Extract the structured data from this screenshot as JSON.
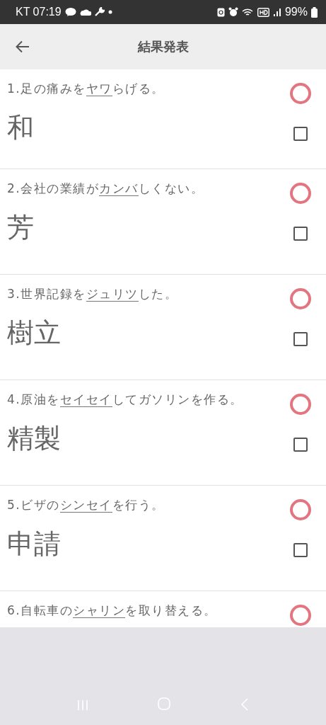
{
  "status_bar": {
    "carrier_time": "KT 07:19",
    "battery": "99%"
  },
  "header": {
    "title": "結果発表"
  },
  "questions": [
    {
      "before": "1.足の痛みを",
      "target": "ヤワ",
      "after": "らげる。",
      "answer": "和",
      "correct": true,
      "checked": false
    },
    {
      "before": "2.会社の業績が",
      "target": "カンバ",
      "after": "しくない。",
      "answer": "芳",
      "correct": true,
      "checked": false
    },
    {
      "before": "3.世界記録を",
      "target": "ジュリツ",
      "after": "した。",
      "answer": "樹立",
      "correct": true,
      "checked": false
    },
    {
      "before": "4.原油を",
      "target": "セイセイ",
      "after": "してガソリンを作る。",
      "answer": "精製",
      "correct": true,
      "checked": false
    },
    {
      "before": "5.ビザの",
      "target": "シンセイ",
      "after": "を行う。",
      "answer": "申請",
      "correct": true,
      "checked": false
    },
    {
      "before": "6.自転車の",
      "target": "シャリン",
      "after": "を取り替える。",
      "correct": true
    }
  ]
}
